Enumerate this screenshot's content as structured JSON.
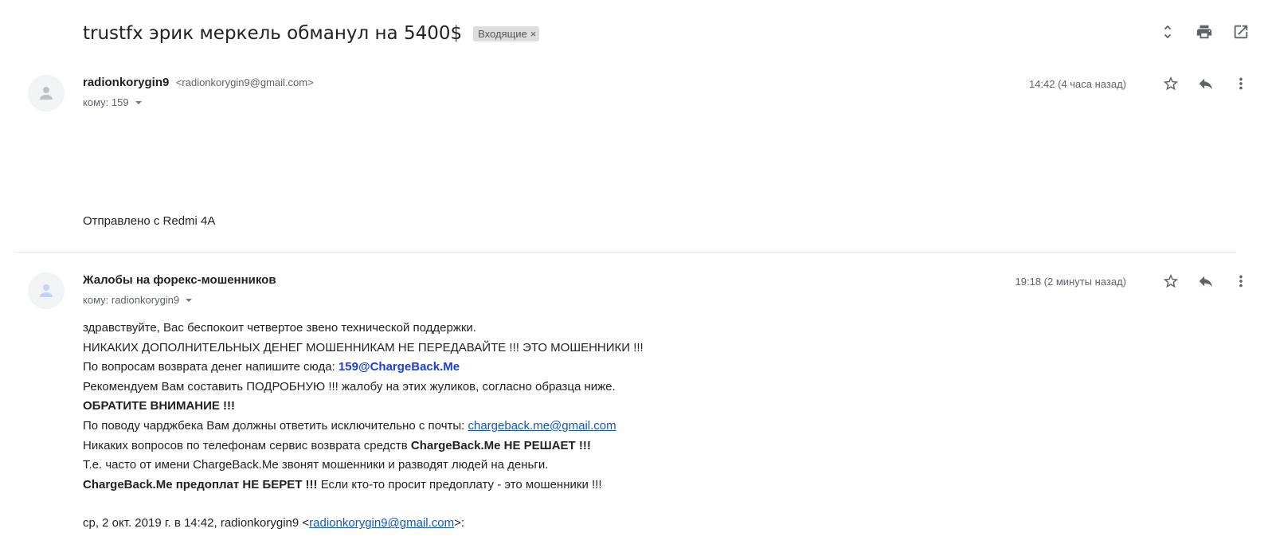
{
  "subject": "trustfx эрик меркель обманул на 5400$",
  "label": {
    "name": "Входящие",
    "remove": "×"
  },
  "top_actions": [
    "expand-collapse-icon",
    "print-icon",
    "open-in-new-window-icon"
  ],
  "messages": [
    {
      "sender_name": "radionkorygin9",
      "sender_email": "<radionkorygin9@gmail.com>",
      "to": "кому: 159",
      "time": "14:42 (4 часа назад)",
      "body": "Отправлено с Redmi 4A"
    },
    {
      "sender_name": "Жалобы на форекс-мошенников",
      "to": "кому: radionkorygin9",
      "time": "19:18 (2 минуты назад)",
      "lines": {
        "l1": "здравствуйте, Вас беспокоит четвертое звено технической поддержки.",
        "l2": "НИКАКИХ ДОПОЛНИТЕЛЬНЫХ ДЕНЕГ МОШЕННИКАМ НЕ ПЕРЕДАВАЙТЕ !!! ЭТО МОШЕННИКИ !!!",
        "l3_prefix": "По вопросам возврата денег напишите сюда: ",
        "l3_email": "159@ChargeBack.Me",
        "l4": "Рекомендуем Вам составить ПОДРОБНУЮ !!! жалобу на этих жуликов, согласно образца ниже.",
        "l5": "ОБРАТИТЕ ВНИМАНИЕ !!!",
        "l6_prefix": "По поводу чарджбека Вам должны ответить исключительно с почты: ",
        "l6_link": "chargeback.me@gmail.com",
        "l7_prefix": "Никаких вопросов по телефонам сервис возврата средств ",
        "l7_bold": "ChargeBack.Me НЕ РЕШАЕТ !!!",
        "l8": "Т.е. часто от имени ChargeBack.Me звонят мошенники и разводят людей на деньги.",
        "l9_bold": "ChargeBack.Me предоплат НЕ БЕРЕТ !!!",
        "l9_rest": " Если кто-то просит предоплату - это мошенники !!!",
        "quote_prefix": "ср, 2 окт. 2019 г. в 14:42, radionkorygin9 <",
        "quote_link": "radionkorygin9@gmail.com",
        "quote_suffix": ">:"
      }
    }
  ],
  "message_actions": [
    "star-icon",
    "reply-icon",
    "more-vert-icon"
  ]
}
